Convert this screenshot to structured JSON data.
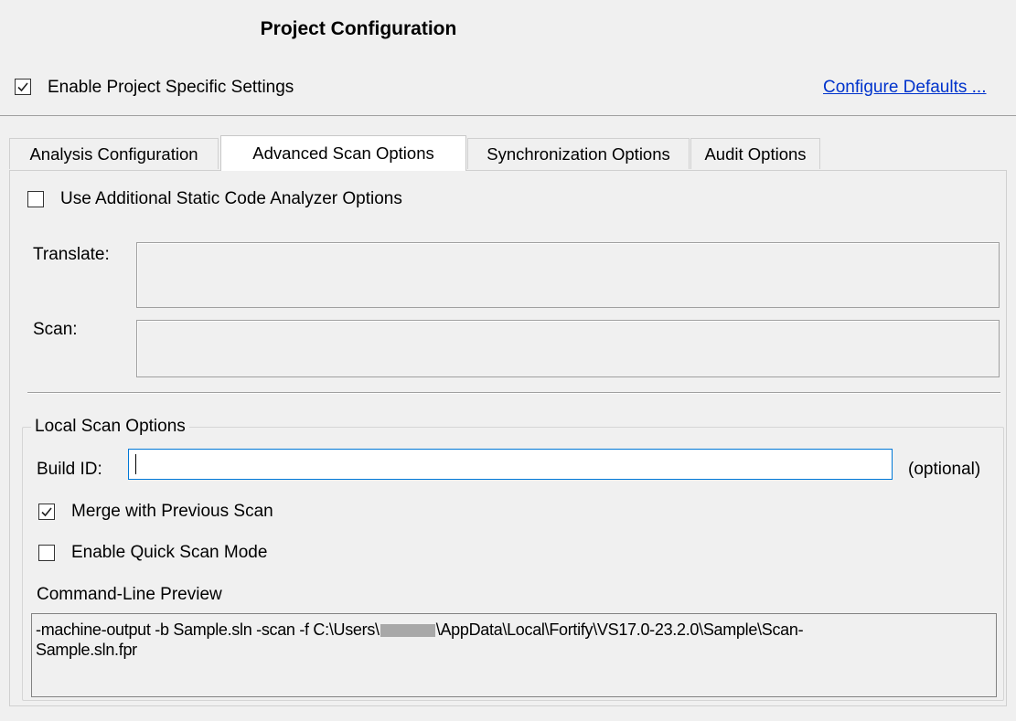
{
  "header": {
    "title": "Project Configuration",
    "enable_project_settings_label": "Enable Project Specific Settings",
    "enable_project_settings_checked": true,
    "configure_defaults_link": "Configure Defaults ..."
  },
  "tabs": [
    {
      "label": "Analysis Configuration",
      "active": false
    },
    {
      "label": "Advanced Scan Options",
      "active": true
    },
    {
      "label": "Synchronization Options",
      "active": false
    },
    {
      "label": "Audit Options",
      "active": false
    }
  ],
  "advanced": {
    "use_additional_label": "Use Additional Static Code Analyzer Options",
    "use_additional_checked": false,
    "translate_label": "Translate:",
    "translate_value": "",
    "scan_label": "Scan:",
    "scan_value": ""
  },
  "local_scan": {
    "group_label": "Local Scan Options",
    "build_id_label": "Build ID:",
    "build_id_value": "",
    "optional_label": "(optional)",
    "merge_label": "Merge with Previous Scan",
    "merge_checked": true,
    "quick_scan_label": "Enable Quick Scan Mode",
    "quick_scan_checked": false,
    "preview_label": "Command-Line Preview",
    "preview_part1": "-machine-output -b Sample.sln -scan -f C:\\Users\\",
    "preview_part2": "\\AppData\\Local\\Fortify\\VS17.0-23.2.0\\Sample\\Scan-",
    "preview_line2": "Sample.sln.fpr"
  }
}
